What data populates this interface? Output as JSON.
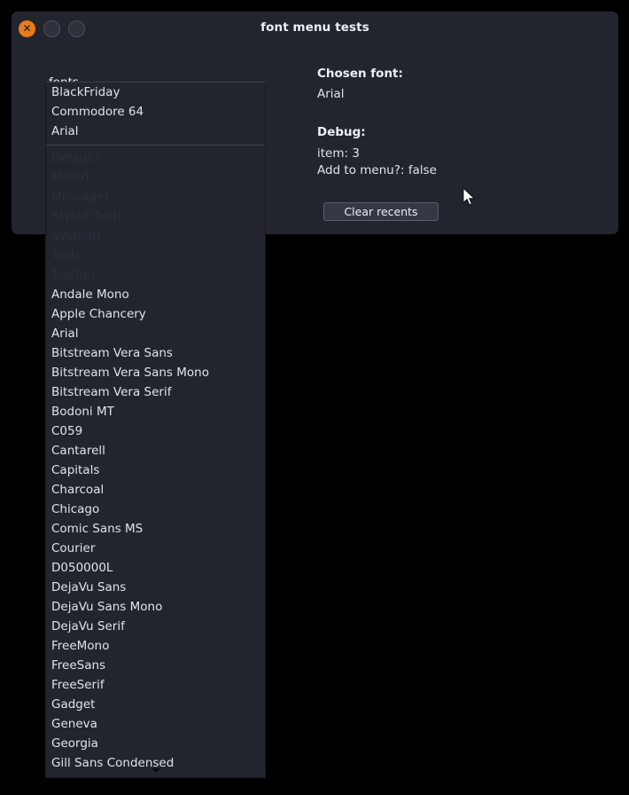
{
  "window": {
    "title": "font menu tests",
    "controls": [
      {
        "name": "close",
        "icon": "close-icon",
        "glyph": "✕",
        "color": "#eb7a18"
      },
      {
        "name": "minimize",
        "icon": "minimize-icon",
        "glyph": "",
        "color": "#2f323d"
      },
      {
        "name": "maximize",
        "icon": "maximize-icon",
        "glyph": "",
        "color": "#2f323d"
      }
    ]
  },
  "left": {
    "fonts_label": "fonts"
  },
  "right": {
    "chosen_font_heading": "Chosen font:",
    "chosen_font_value": "Arial",
    "debug_heading": "Debug:",
    "debug_lines": [
      "item: 3",
      "Add to menu?: false"
    ],
    "clear_recents_label": "Clear recents"
  },
  "dropdown": {
    "recents": [
      "BlackFriday",
      "Commodore 64",
      "Arial"
    ],
    "disabled_items": [
      "Default)",
      "Menu)",
      "Message)",
      "Styled Text)",
      "System)",
      "Text)",
      "Tooltip)"
    ],
    "fonts": [
      "Andale Mono",
      "Apple Chancery",
      "Arial",
      "Bitstream Vera Sans",
      "Bitstream Vera Sans Mono",
      "Bitstream Vera Serif",
      "Bodoni MT",
      "C059",
      "Cantarell",
      "Capitals",
      "Charcoal",
      "Chicago",
      "Comic Sans MS",
      "Courier",
      "D050000L",
      "DejaVu Sans",
      "DejaVu Sans Mono",
      "DejaVu Serif",
      "FreeMono",
      "FreeSans",
      "FreeSerif",
      "Gadget",
      "Geneva",
      "Georgia",
      "Gill Sans Condensed"
    ],
    "scroll_down_icon": "chevron-down-icon"
  },
  "colors": {
    "window_bg": "#22252e",
    "desktop_bg": "#000000",
    "accent_orange": "#eb7a18",
    "text": "#dfe3ea",
    "text_disabled": "#2b2f3b"
  }
}
